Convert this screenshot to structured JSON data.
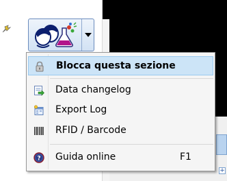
{
  "menu": {
    "items": [
      {
        "label": "Blocca questa sezione",
        "icon": "lock-icon",
        "highlighted": true
      },
      {
        "label": "Data changelog",
        "icon": "data-changelog-icon"
      },
      {
        "label": "Export Log",
        "icon": "export-log-icon"
      },
      {
        "label": "RFID / Barcode",
        "icon": "barcode-icon"
      },
      {
        "label": "Guida online",
        "icon": "help-icon",
        "shortcut": "F1"
      }
    ]
  },
  "toolbar": {
    "split_button_icon": "users-lab-icon",
    "dropdown_icon": "chevron-down-icon"
  },
  "background": {
    "plus_label": "+"
  },
  "colors": {
    "highlight": "#cce4f7",
    "highlight_border": "#99c9ef",
    "menu_bg": "#f5f5f5"
  }
}
